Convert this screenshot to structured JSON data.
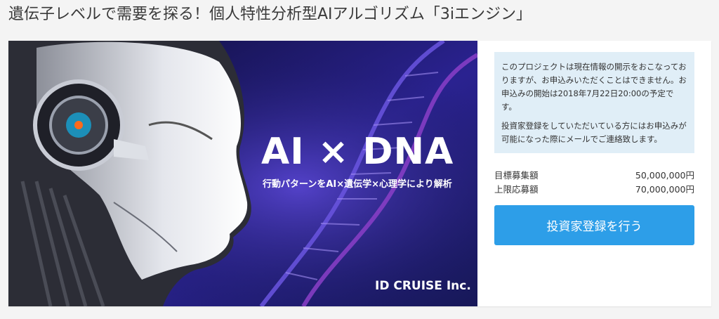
{
  "page": {
    "title": "遺伝子レベルで需要を探る！個人特性分析型AIアルゴリズム「3iエンジン」"
  },
  "hero": {
    "headline": "AI × DNA",
    "subtitle": "行動パターンをAI×遺伝学×心理学により解析",
    "brand": "ID CRUISE Inc."
  },
  "notice": {
    "paragraph1": "このプロジェクトは現在情報の開示をおこなっておりますが、お申込みいただくことはできません。お申込みの開始は2018年7月22日20:00の予定です。",
    "paragraph2": "投資家登録をしていただいている方にはお申込みが可能になった際にメールでご連絡致します。"
  },
  "amounts": {
    "target_label": "目標募集額",
    "target_value": "50,000,000円",
    "max_label": "上限応募額",
    "max_value": "70,000,000円"
  },
  "cta": {
    "label": "投資家登録を行う"
  },
  "colors": {
    "accent": "#2d9ee8",
    "notice_bg": "#e0eef7",
    "hero_bg": "#12124a"
  }
}
